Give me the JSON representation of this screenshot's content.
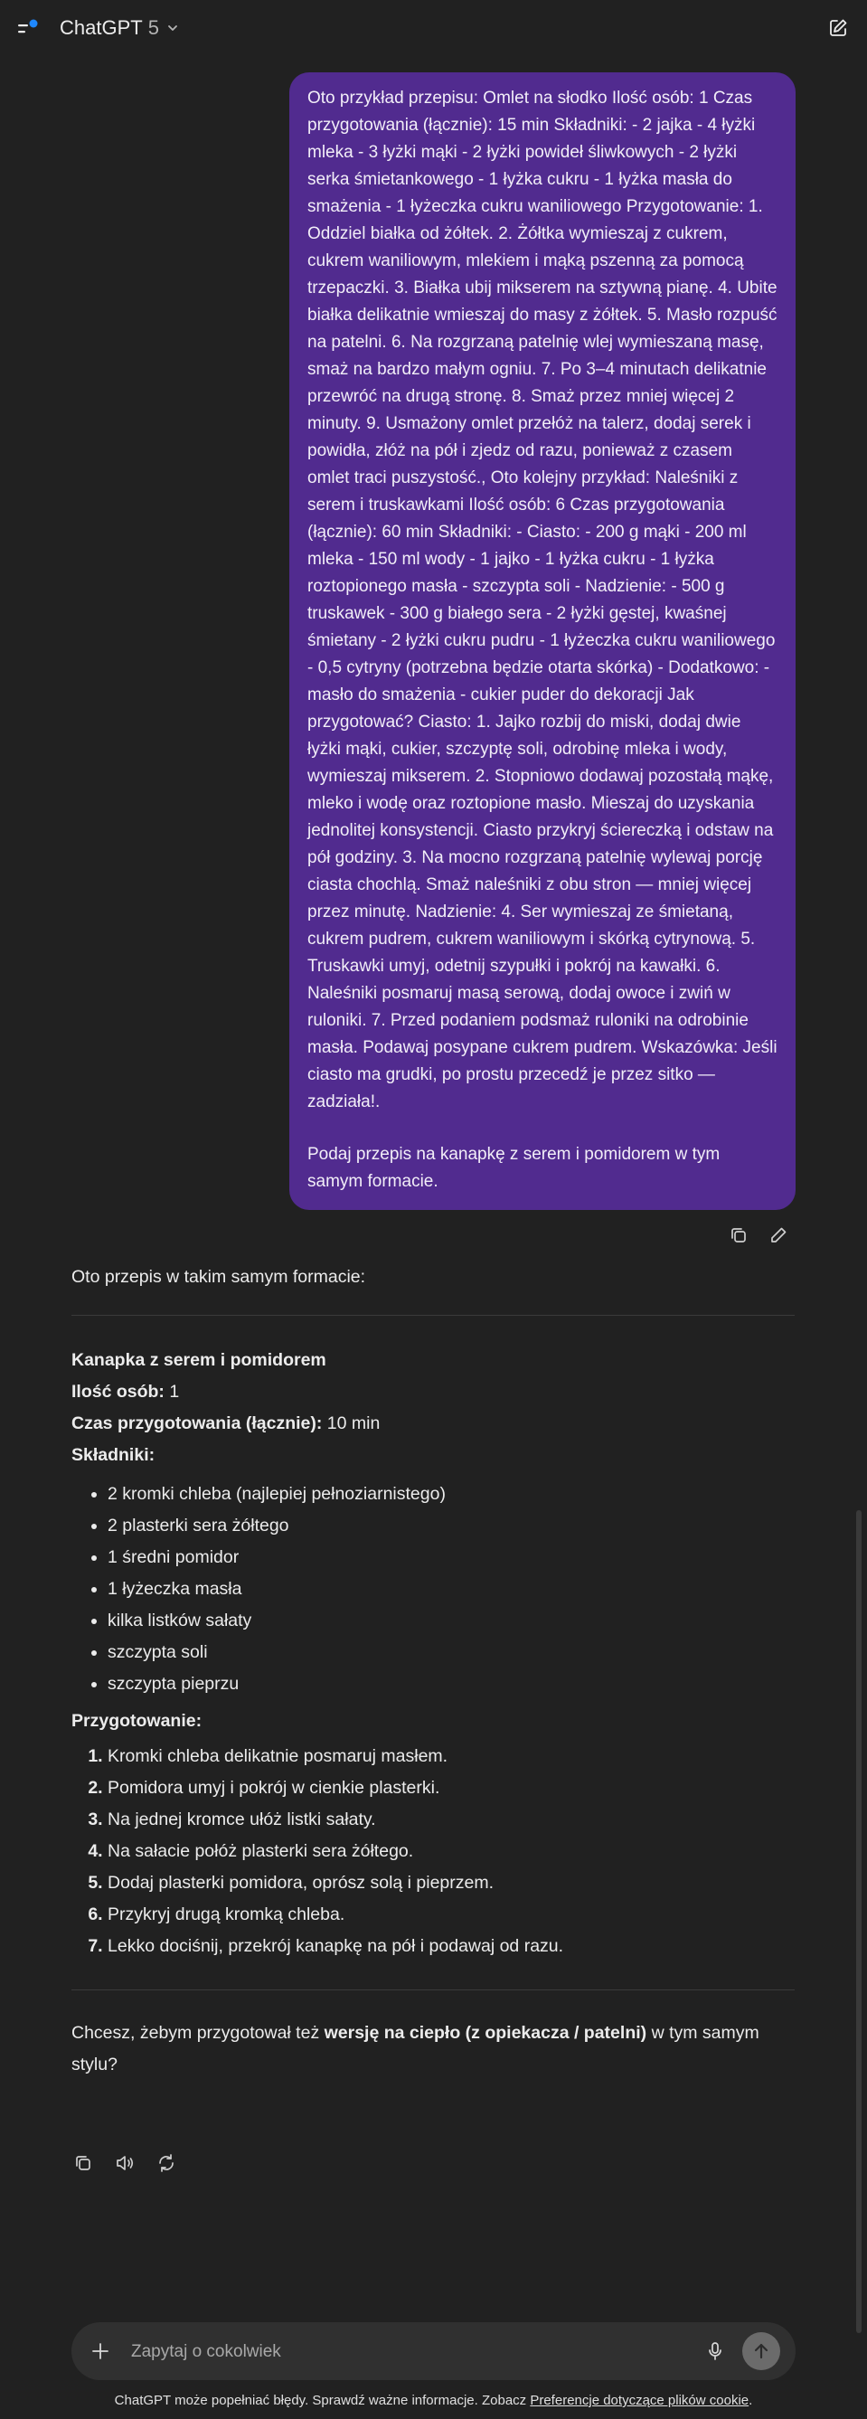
{
  "header": {
    "title": "ChatGPT",
    "version": "5",
    "colors": {
      "background": "#212121",
      "user_bubble": "#512b8f",
      "notification_dot": "#1e88ff"
    }
  },
  "user_message": {
    "paragraph1": "Oto przykład przepisu: Omlet na słodko Ilość osób: 1 Czas przygotowania (łącznie): 15 min Składniki: - 2 jajka - 4 łyżki mleka - 3 łyżki mąki - 2 łyżki powideł śliwkowych - 2 łyżki serka śmietankowego - 1 łyżka cukru - 1 łyżka masła do smażenia - 1 łyżeczka cukru waniliowego Przygotowanie: 1. Oddziel białka od żółtek. 2. Żółtka wymieszaj z cukrem, cukrem waniliowym, mlekiem i mąką pszenną za pomocą trzepaczki. 3. Białka ubij mikserem na sztywną pianę. 4. Ubite białka delikatnie wmieszaj do masy z żółtek. 5. Masło rozpuść na patelni. 6. Na rozgrzaną patelnię wlej wymieszaną masę, smaż na bardzo małym ogniu. 7. Po 3–4 minutach delikatnie przewróć na drugą stronę. 8. Smaż przez mniej więcej 2 minuty. 9. Usmażony omlet przełóż na talerz, dodaj serek i powidła, złóż na pół i zjedz od razu, ponieważ z czasem omlet traci puszystość., Oto kolejny przykład: Naleśniki z serem i truskawkami Ilość osób: 6 Czas przygotowania (łącznie): 60 min Składniki: - Ciasto: - 200 g mąki - 200 ml mleka - 150 ml wody - 1 jajko - 1 łyżka cukru - 1 łyżka roztopionego masła - szczypta soli - Nadzienie: - 500 g truskawek - 300 g białego sera - 2 łyżki gęstej, kwaśnej śmietany - 2 łyżki cukru pudru - 1 łyżeczka cukru waniliowego - 0,5 cytryny (potrzebna będzie otarta skórka) - Dodatkowo: - masło do smażenia - cukier puder do dekoracji Jak przygotować? Ciasto: 1. Jajko rozbij do miski, dodaj dwie łyżki mąki, cukier, szczyptę soli, odrobinę mleka i wody, wymieszaj mikserem. 2. Stopniowo dodawaj pozostałą mąkę, mleko i wodę oraz roztopione masło. Mieszaj do uzyskania jednolitej konsystencji. Ciasto przykryj ściereczką i odstaw na pół godziny. 3. Na mocno rozgrzaną patelnię wylewaj porcję ciasta chochlą. Smaż naleśniki z obu stron — mniej więcej przez minutę. Nadzienie: 4. Ser wymieszaj ze śmietaną, cukrem pudrem, cukrem waniliowym i skórką cytrynową. 5. Truskawki umyj, odetnij szypułki i pokrój na kawałki. 6. Naleśniki posmaruj masą serową, dodaj owoce i zwiń w ruloniki. 7. Przed podaniem podsmaż ruloniki na odrobinie masła. Podawaj posypane cukrem pudrem. Wskazówka: Jeśli ciasto ma grudki, po prostu przecedź je przez sitko — zadziała!.",
    "paragraph2": "Podaj przepis na kanapkę z serem i pomidorem w tym samym formacie."
  },
  "assistant_message": {
    "intro": "Oto przepis w takim samym formacie:",
    "recipe_title": "Kanapka z serem i pomidorem",
    "servings_label": "Ilość osób:",
    "servings_value": " 1",
    "time_label": "Czas przygotowania (łącznie):",
    "time_value": " 10 min",
    "ingredients_heading": "Składniki:",
    "ingredients": [
      "2 kromki chleba (najlepiej pełnoziarnistego)",
      "2 plasterki sera żółtego",
      "1 średni pomidor",
      "1 łyżeczka masła",
      "kilka listków sałaty",
      "szczypta soli",
      "szczypta pieprzu"
    ],
    "steps_heading": "Przygotowanie:",
    "steps": [
      "Kromki chleba delikatnie posmaruj masłem.",
      "Pomidora umyj i pokrój w cienkie plasterki.",
      "Na jednej kromce ułóż listki sałaty.",
      "Na sałacie połóż plasterki sera żółtego.",
      "Dodaj plasterki pomidora, oprósz solą i pieprzem.",
      "Przykryj drugą kromką chleba.",
      "Lekko dociśnij, przekrój kanapkę na pół i podawaj od razu."
    ],
    "followup_before": "Chcesz, żebym przygotował też ",
    "followup_bold": "wersję na ciepło (z opiekacza / patelni)",
    "followup_after": " w tym samym stylu?"
  },
  "composer": {
    "placeholder": "Zapytaj o cokolwiek"
  },
  "footer": {
    "note": "ChatGPT może popełniać błędy. Sprawdź ważne informacje. Zobacz ",
    "link": "Preferencje dotyczące plików cookie",
    "end": "."
  }
}
